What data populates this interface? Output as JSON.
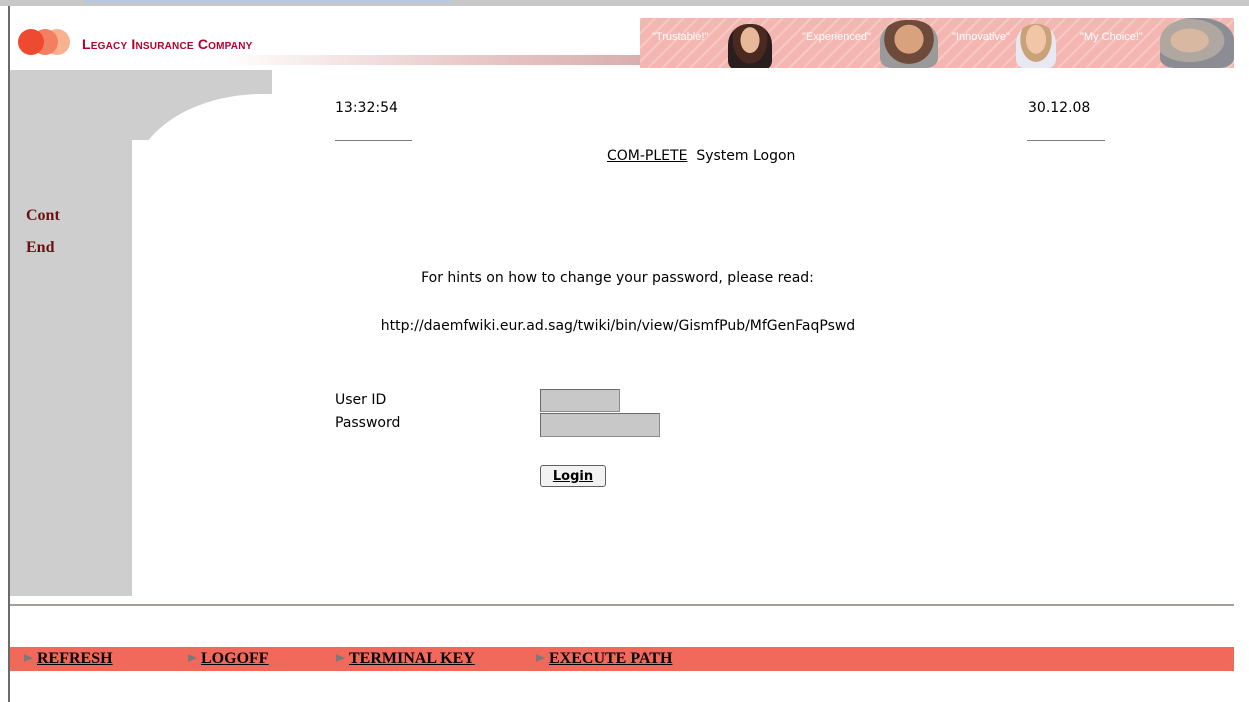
{
  "header": {
    "company_name": "Legacy Insurance Company",
    "taglines": [
      "\"Trustable!\"",
      "\"Experienced\"",
      "\"Innovative\"",
      "\"My Choice!\""
    ]
  },
  "sidebar": {
    "items": [
      {
        "label": "Cont"
      },
      {
        "label": "End"
      }
    ]
  },
  "status": {
    "time": "13:32:54",
    "date": "30.12.08"
  },
  "title": {
    "link": "COM-PLETE",
    "text": "System Logon"
  },
  "hints": {
    "line1": "For hints on how to change your password, please read:",
    "url": "http://daemfwiki.eur.ad.sag/twiki/bin/view/GismfPub/MfGenFaqPswd"
  },
  "form": {
    "user_id_label": "User ID",
    "password_label": "Password",
    "user_id_value": "",
    "password_value": "",
    "login_label": "Login"
  },
  "menu": {
    "items": [
      {
        "label": "REFRESH"
      },
      {
        "label": "LOGOFF"
      },
      {
        "label": "TERMINAL KEY"
      },
      {
        "label": "EXECUTE PATH"
      }
    ]
  },
  "colors": {
    "brand_red": "#b3002d",
    "menubar": "#f2685a",
    "sidebar": "#cecece",
    "side_link": "#6b1010"
  },
  "icons": [
    "logo-circles-icon",
    "arrow-right-icon"
  ]
}
